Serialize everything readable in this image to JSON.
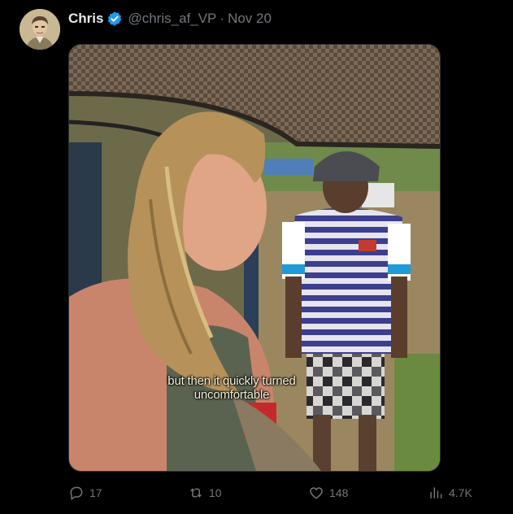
{
  "tweet": {
    "author_name": "Chris",
    "handle": "@chris_af_VP",
    "separator": "·",
    "date": "Nov 20",
    "video_caption_line1": "but then it quickly turned",
    "video_caption_line2": "uncomfortable"
  },
  "actions": {
    "replies": "17",
    "reposts": "10",
    "likes": "148",
    "views": "4.7K"
  },
  "colors": {
    "background": "#000000",
    "text_primary": "#e7e9ea",
    "text_secondary": "#71767b",
    "verified_badge": "#1d9bf0"
  },
  "icons": {
    "verified": "verified-badge-icon",
    "reply": "reply-icon",
    "repost": "repost-icon",
    "like": "heart-icon",
    "views": "views-chart-icon"
  }
}
